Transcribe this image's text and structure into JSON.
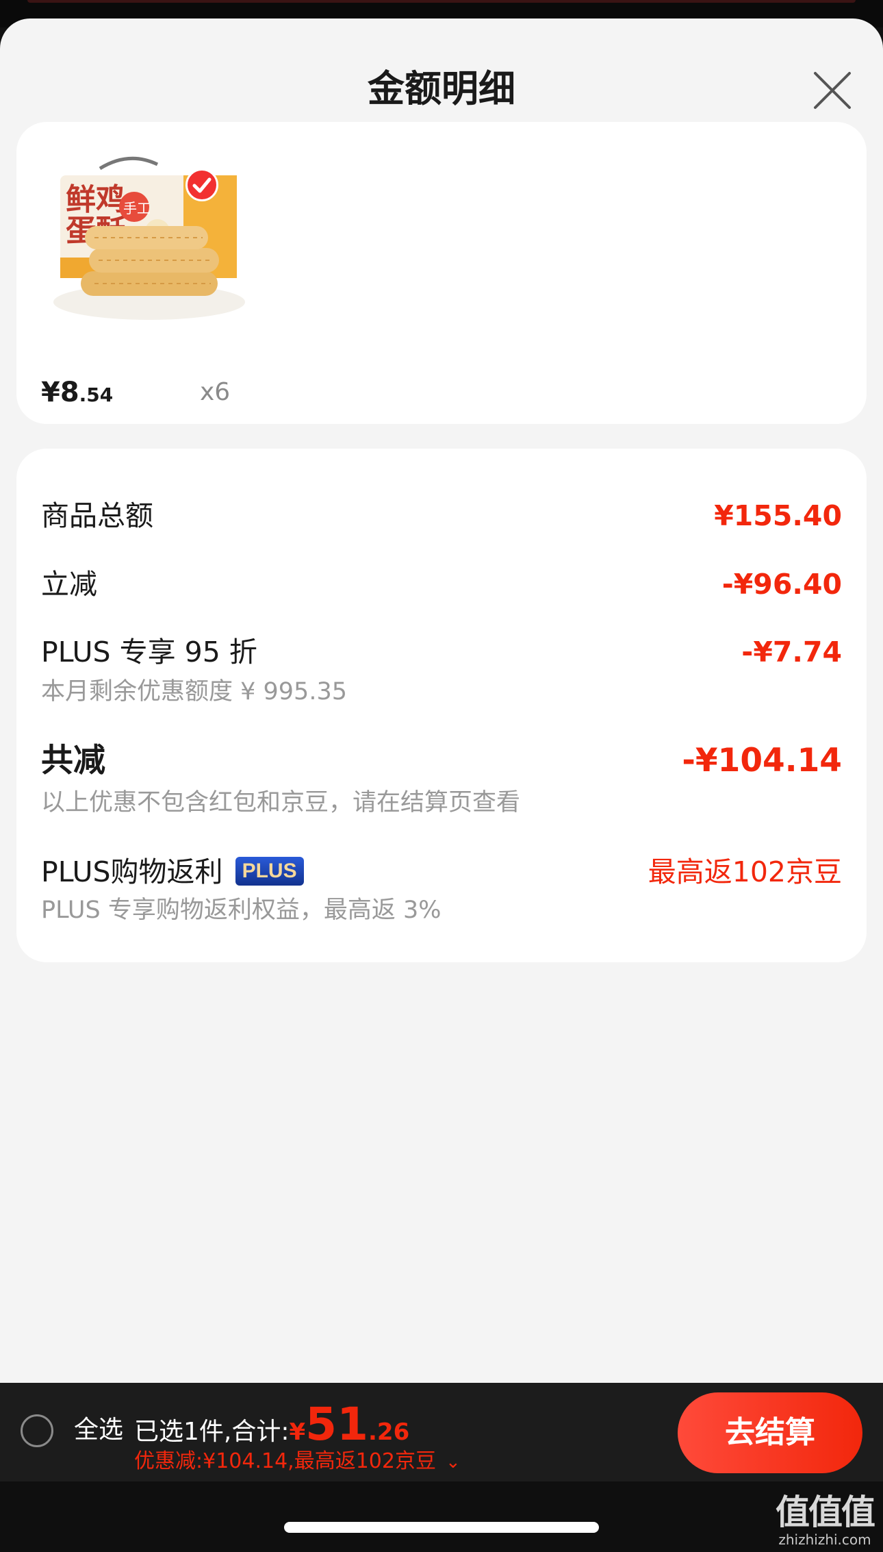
{
  "sheet": {
    "title": "金额明细"
  },
  "product": {
    "thumb_icon": "egg-roll-snack-box-image",
    "selected": true,
    "price_int": "¥8",
    "price_dec": ".54",
    "quantity": "x6"
  },
  "details": {
    "goods_total_label": "商品总额",
    "goods_total_value": "¥155.40",
    "instant_discount_label": "立减",
    "instant_discount_value": "-¥96.40",
    "plus_discount_label": "PLUS 专享 95 折",
    "plus_discount_value": "-¥7.74",
    "plus_discount_sub": "本月剩余优惠额度 ¥ 995.35",
    "total_reduction_label": "共减",
    "total_reduction_value": "-¥104.14",
    "total_reduction_sub": "以上优惠不包含红包和京豆，请在结算页查看",
    "rebate_label": "PLUS购物返利",
    "rebate_tag": "PLUS",
    "rebate_value": "最高返102京豆",
    "rebate_sub": "PLUS 专享购物返利权益，最高返 3%"
  },
  "bottom_bar": {
    "select_all_label": "全选",
    "summary_prefix": "已选1件,合计:",
    "total_yen": "¥",
    "total_int": "51",
    "total_dec": ".26",
    "saving_text": "优惠减:¥104.14,最高返102京豆",
    "checkout_label": "去结算"
  },
  "watermark": {
    "logo_text": "值值值",
    "url_text": "zhizhizhi.com"
  },
  "colors": {
    "accent_red": "#f2270c",
    "sheet_bg": "#f4f4f4",
    "bar_bg": "#1c1c1c"
  }
}
